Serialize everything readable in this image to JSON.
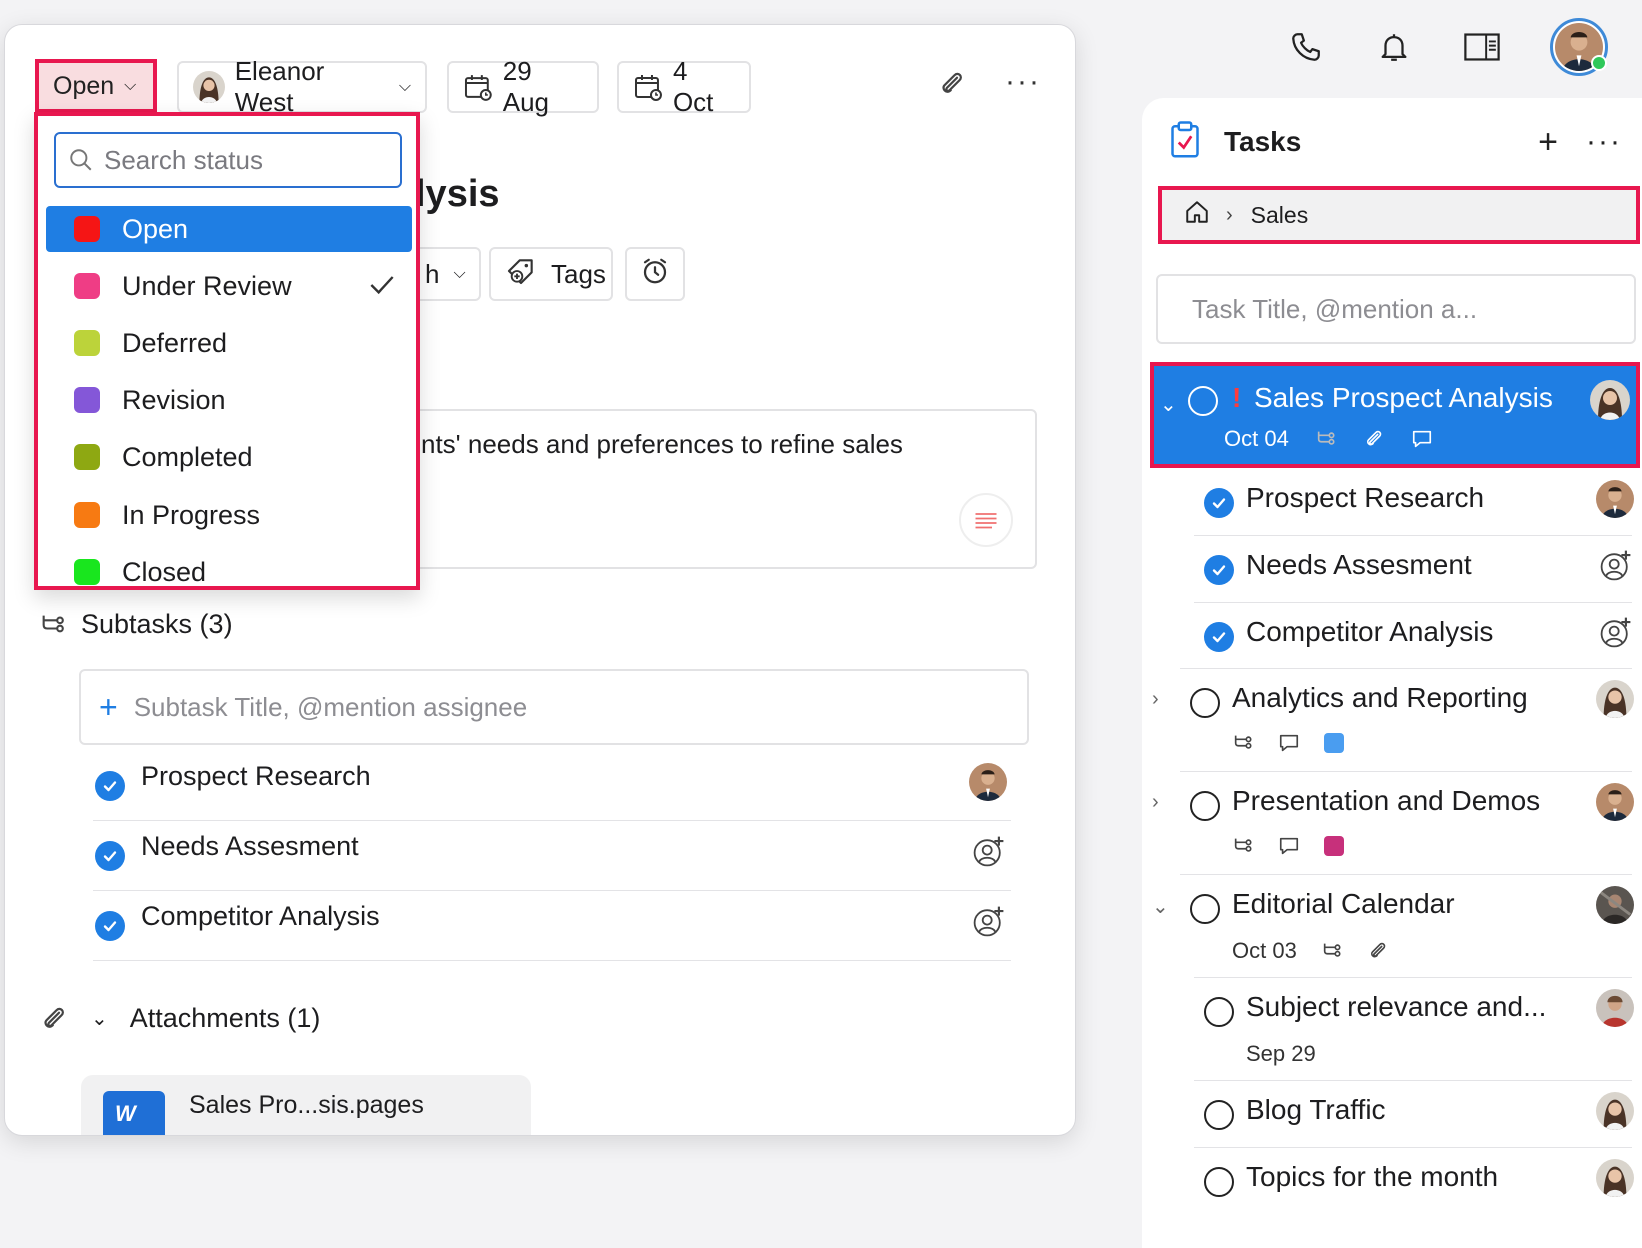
{
  "header": {
    "icons": [
      "phone-icon",
      "bell-icon",
      "sidebar-panel-icon",
      "user-avatar"
    ]
  },
  "task_detail": {
    "status_button": "Open",
    "assignee": "Eleanor West",
    "start_date": "29 Aug",
    "due_date": "4 Oct",
    "title_fragment": "lysis",
    "chip_fragment": "h",
    "tags_label": "Tags",
    "description_fragment": "nts' needs and preferences to refine sales",
    "subtasks_heading": "Subtasks (3)",
    "subtask_placeholder": "Subtask Title, @mention assignee",
    "subtasks": [
      {
        "name": "Prospect Research",
        "assignee": "avatar"
      },
      {
        "name": "Needs Assesment",
        "assignee": "add-assignee"
      },
      {
        "name": "Competitor Analysis",
        "assignee": "add-assignee"
      }
    ],
    "attachments_heading": "Attachments (1)",
    "attachment_file": "Sales Pro...sis.pages",
    "attachment_icon_text": "W"
  },
  "status_dropdown": {
    "search_placeholder": "Search status",
    "options": [
      {
        "label": "Open",
        "color": "#f51515",
        "active": true
      },
      {
        "label": "Under Review",
        "color": "#ef3d85",
        "checked": true
      },
      {
        "label": "Deferred",
        "color": "#bcd33a"
      },
      {
        "label": "Revision",
        "color": "#8457d8"
      },
      {
        "label": "Completed",
        "color": "#8ea812"
      },
      {
        "label": "In Progress",
        "color": "#f77a12"
      },
      {
        "label": "Closed",
        "color": "#19e61e"
      }
    ]
  },
  "tasks_panel": {
    "title": "Tasks",
    "breadcrumb": "Sales",
    "input_placeholder": "Task Title, @mention a...",
    "selected_task": {
      "name": "Sales Prospect Analysis",
      "date": "Oct 04"
    },
    "items": [
      {
        "name": "Prospect Research",
        "done": true
      },
      {
        "name": "Needs Assesment",
        "done": true
      },
      {
        "name": "Competitor Analysis",
        "done": true
      },
      {
        "name": "Analytics and Reporting",
        "done": false,
        "tag_color": "#4a9df0"
      },
      {
        "name": "Presentation and Demos",
        "done": false,
        "tag_color": "#c7307b"
      },
      {
        "name": "Editorial Calendar",
        "done": false,
        "date": "Oct 03"
      },
      {
        "name": "Subject relevance and...",
        "done": false,
        "date": "Sep 29"
      },
      {
        "name": "Blog Traffic",
        "done": false
      },
      {
        "name": "Topics for the month",
        "done": false
      }
    ]
  },
  "colors": {
    "accent": "#1f7ee3",
    "highlight": "#e8174f"
  }
}
